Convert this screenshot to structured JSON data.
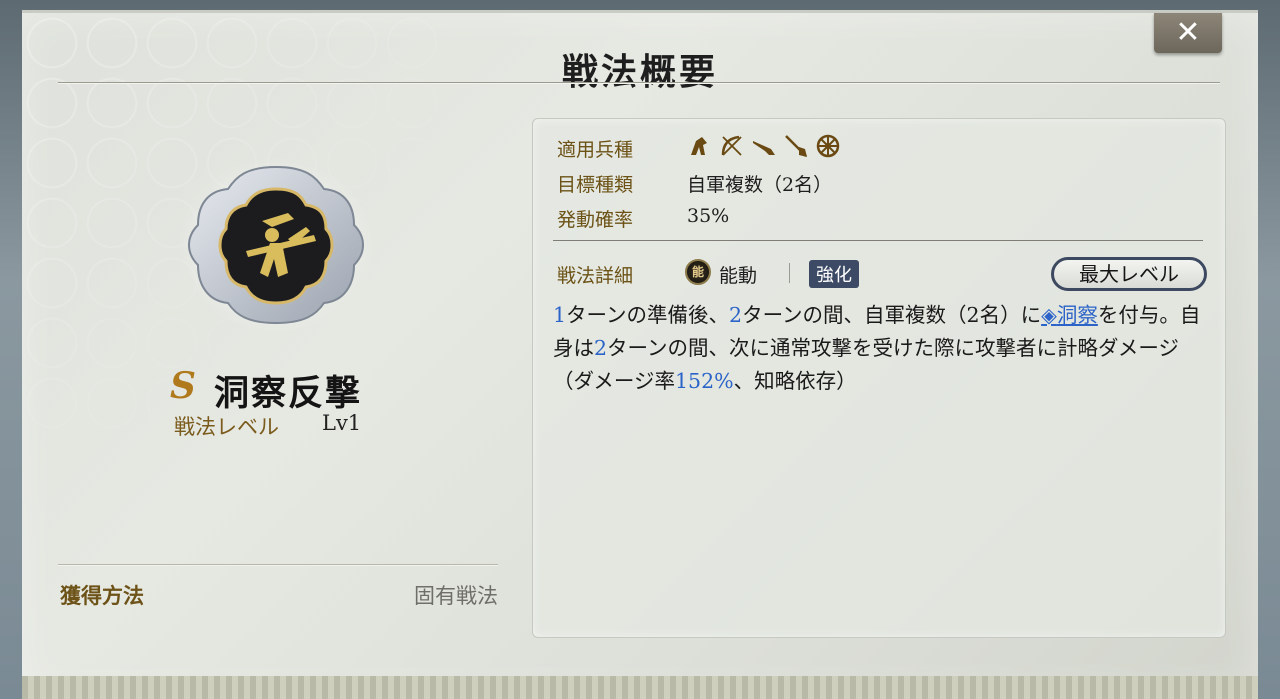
{
  "window": {
    "title": "戦法概要",
    "close_label": "✕"
  },
  "skill": {
    "grade": "S",
    "name": "洞察反撃",
    "level_label": "戦法レベル",
    "level_value": "Lv1",
    "acquisition_label": "獲得方法",
    "acquisition_value": "固有戦法"
  },
  "details": {
    "unit_types_label": "適用兵種",
    "unit_type_icons": [
      "cavalry-icon",
      "archer-icon",
      "gun-icon",
      "spear-icon",
      "siege-wheel-icon"
    ],
    "target_label": "目標種類",
    "target_value": "自軍複数（2名）",
    "rate_label": "発動確率",
    "rate_value": "35%",
    "skill_detail_label": "戦法詳細",
    "activation_icon_text": "能",
    "activation_type": "能動",
    "enhance_badge": "強化",
    "max_level_button": "最大レベル",
    "description": {
      "n1": "1",
      "t1": "ターンの準備後、",
      "n2": "2",
      "t2": "ターンの間、自軍複数（2名）に",
      "link_icon": "◈",
      "link_text": "洞察",
      "t3": "を付与。自身は",
      "n3": "2",
      "t4": "ターンの間、次に通常攻撃を受けた際に攻撃者に計略ダメージ（ダメージ率",
      "n4": "152%",
      "t5": "、知略依存）"
    }
  },
  "colors": {
    "gold_label": "#6c5216",
    "highlight_blue": "#2b63c8",
    "badge_navy": "#3d4a66"
  }
}
